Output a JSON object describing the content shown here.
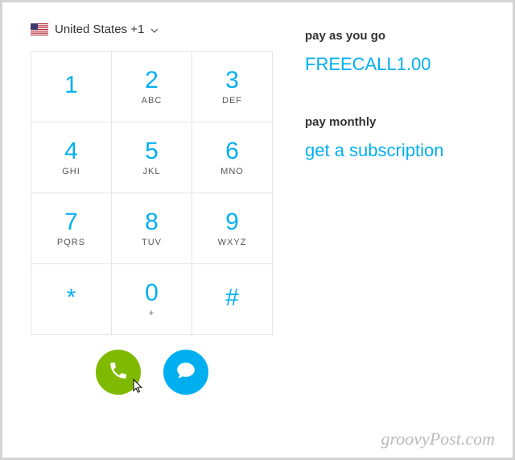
{
  "country": {
    "label": "United States +1",
    "flag": "us"
  },
  "keypad": [
    [
      {
        "num": "1",
        "sub": ""
      },
      {
        "num": "2",
        "sub": "ABC"
      },
      {
        "num": "3",
        "sub": "DEF"
      }
    ],
    [
      {
        "num": "4",
        "sub": "GHI"
      },
      {
        "num": "5",
        "sub": "JKL"
      },
      {
        "num": "6",
        "sub": "MNO"
      }
    ],
    [
      {
        "num": "7",
        "sub": "PQRS"
      },
      {
        "num": "8",
        "sub": "TUV"
      },
      {
        "num": "9",
        "sub": "WXYZ"
      }
    ],
    [
      {
        "num": "*",
        "sub": ""
      },
      {
        "num": "0",
        "sub": "+"
      },
      {
        "num": "#",
        "sub": ""
      }
    ]
  ],
  "payg": {
    "label": "pay as you go",
    "value": "FREECALL1.00"
  },
  "monthly": {
    "label": "pay monthly",
    "link": "get a subscription"
  },
  "watermark": "groovyPost.com"
}
